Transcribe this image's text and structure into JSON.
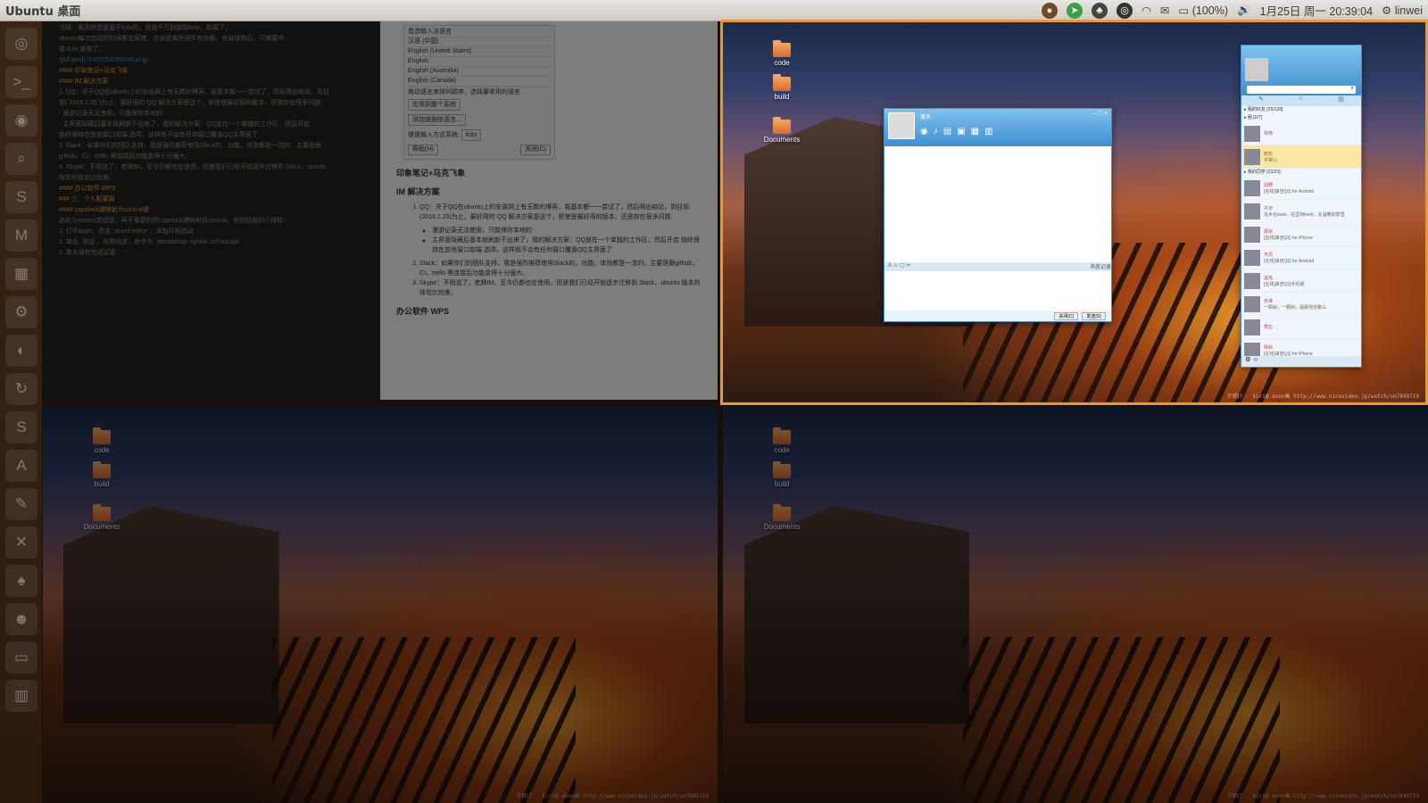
{
  "topbar": {
    "title": "Ubuntu 桌面",
    "battery": "(100%)",
    "datetime": "1月25日 周一 20:39:04",
    "user": "linwei"
  },
  "launcher": {
    "icons": [
      "ubuntu-icon",
      "terminal-icon",
      "chrome-icon",
      "search-icon",
      "sublime-icon",
      "gmail-icon",
      "apps-icon",
      "settings-icon",
      "firefox-icon",
      "update-icon",
      "skype-icon",
      "software-center-icon",
      "pen-icon",
      "tools-icon",
      "evernote-icon",
      "qq-icon",
      "file-manager-icon",
      "trash-icon"
    ]
  },
  "desktop": {
    "folders": [
      "code",
      "build",
      "Documents"
    ],
    "credit": "夕焼け · kiri@ anon画 http://www.nicovideo.jp/watch/sm7849719"
  },
  "editor": {
    "lines": [
      "注释：虽则拼音是基于fcitx的，但是千万别卸掉fcitx，卸载了，",
      "ubuntu每次启动的时候都会报错，应该是某些组件有依赖。安装搜狗后，只需要将",
      "成 fcitx 就够了。",
      "![Alt text](./1453724296535.png)",
      "#### 印象笔记+马克飞象",
      "#### IM 解决方案",
      "1. QQ：关于QQ在ubuntu上的安装网上有无数的博客，我基本都一一尝试了，然后得出结论，到目",
      "前(`2016.1.25`)为止，最好用的 QQ 解决方案是这个，即使是最好用的版本，还是存在很多问题:",
      "  - 漫游记录无法使用，只能保存本地的",
      "  - 主界面隐藏后基本就刷新不出来了，我的解决方案：QQ放在一个单独的工作区，然后开启",
      "始终保持在其他窗口前端 选项，这样就不会有任何窗口覆盖QQ主界面了",
      "2. Slack：如果你们的团队支持，我是强烈推荐使用Slack的，功能，体验都是一流的，主要是跟",
      "github，CI，trello 等连接后功能变得十分强大。",
      "3. Skype：不用说了，老牌IM，至今仍都也在使用，但是我们已经开始逐步迁移到 Slack，ubuntu",
      "版本的体验比较差。",
      "#### 办公软件 WPS",
      "### 三、个人配置篇",
      "#### capslock键映射为control键",
      "此处为emacs党福音，再不需要的把capslock键映射成control，告别扭曲的小拇指：",
      "1. 打开dash，点击 `dconf-editor`，添加开机启动",
      "2. 单击 `添加`，名称自定，命令为 `setxkbmap -option ctrl:nocaps`",
      "3. 单击保存完成设置"
    ]
  },
  "preview": {
    "prefs_title": "首选输入法语言",
    "prefs_items": [
      "汉语 (中国)",
      "English (United States)",
      "English",
      "English (Australia)",
      "English (Canada)"
    ],
    "prefs_note1": "拖动语言来排列顺序，选择最常用的语言",
    "prefs_note2": "应用到整个系统",
    "prefs_note3": "添加或删除语言...",
    "prefs_input": "键盘输入方式系统:",
    "prefs_input_val": "fcitx",
    "help": "帮助(H)",
    "close": "关闭(C)",
    "h_evernote": "印象笔记+马克飞象",
    "h_im": "IM 解决方案",
    "item1": "QQ：关于QQ在ubuntu上的安装网上有无数的博客，我基本都一一尝试了，然后得出结论，到目前(2016.1.25)为止，最好用的 QQ 解决方案是这个，即使是最好用的版本，还是存在很多问题:",
    "sub1": "漫游记录无法使用，只能保存本地的",
    "sub2": "主界面隐藏后基本就刷新不出来了，我的解决方案：QQ放在一个单独的工作区，然后开启 始终保持在其他窗口前端 选项，这样就不会有任何窗口覆盖QQ主界面了",
    "item2": "Slack：如果你们的团队支持，我是强烈推荐使用Slack的，功能，体验都是一流的，主要是跟github，CI，trello 等连接后功能变得十分强大。",
    "item3": "Skype：不用说了，老牌IM，至今仍都也在使用，但是我们已经开始逐步迁移到 Slack，ubuntu 版本的体验比较差。",
    "h_wps": "办公软件 WPS"
  },
  "qqchat": {
    "name": "蒲天",
    "close_btn": "关闭(C)",
    "send_btn": "发送(S)",
    "history": "消息记录"
  },
  "qqmain": {
    "groups": [
      "我的好友 [25/139]",
      "朋 [0/7]",
      "我的同学 [23/23]"
    ],
    "contacts": [
      {
        "name": "林桦",
        "status": ""
      },
      {
        "name": "晓天",
        "status": "平常心"
      },
      {
        "name": "阔野",
        "status": "[在线]来自QQ for Android"
      },
      {
        "name": "平京",
        "status": "在木也iweb，在坚持iweb，在温暖的梦里"
      },
      {
        "name": "振京",
        "status": "[在线]来自QQ for iPhone"
      },
      {
        "name": "天风",
        "status": "[在线]来自QQ for Android"
      },
      {
        "name": "凌克",
        "status": "[在线]来自QQ手机版"
      },
      {
        "name": "赤准",
        "status": "一颗树，一颗树，温柔地活着么"
      },
      {
        "name": "秀庄",
        "status": ""
      },
      {
        "name": "杨秋",
        "status": "[在线]来自QQ for iPhone"
      }
    ]
  }
}
